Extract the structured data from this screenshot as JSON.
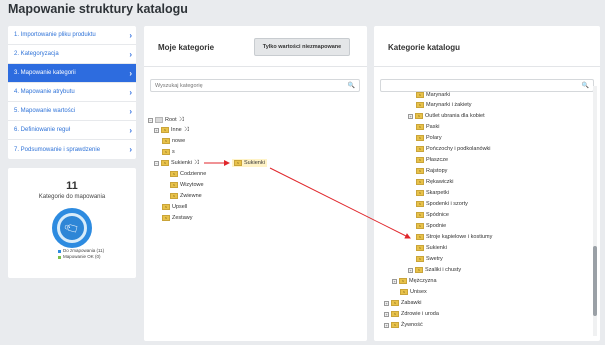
{
  "page": {
    "title": "Mapowanie struktury katalogu"
  },
  "steps": [
    {
      "label": "1. Importowanie pliku produktu",
      "active": false
    },
    {
      "label": "2. Kategoryzacja",
      "active": false
    },
    {
      "label": "3. Mapowanie kategorii",
      "active": true
    },
    {
      "label": "4. Mapowanie atrybutu",
      "active": false
    },
    {
      "label": "5. Mapowanie wartości",
      "active": false
    },
    {
      "label": "6. Definiowanie reguł",
      "active": false
    },
    {
      "label": "7. Podsumowanie i sprawdzenie",
      "active": false
    }
  ],
  "stats": {
    "count": "11",
    "label": "Kategorie do mapowania",
    "legend": [
      {
        "label": "Do zmapowania (11)",
        "color": "#2d8be0"
      },
      {
        "label": "Mapowanie OK (0)",
        "color": "#7cc04b"
      }
    ]
  },
  "left_panel": {
    "title": "Moje kategorie",
    "button": "Tylko wartości niezmapowane",
    "search_placeholder": "Wyszukaj kategorię",
    "tree": {
      "root": "Root",
      "inne": "Inne",
      "nowe": "nowe",
      "s": "s",
      "sukienki": "Sukienki",
      "codzienne": "Codzienne",
      "wizytowe": "Wizytowe",
      "zwiewne": "Zwiewne",
      "upsell": "Upsell",
      "zestawy": "Zestawy",
      "mapped_to": "Sukienki"
    }
  },
  "right_panel": {
    "title": "Kategorie katalogu",
    "search_placeholder": "",
    "tree": [
      "Marynarki",
      "Marynarki i żakiety",
      "Outlet ubrania dla kobiet",
      "Paski",
      "Polary",
      "Pończochy i podkolanówki",
      "Płaszcze",
      "Rajstopy",
      "Rękawiczki",
      "Skarpetki",
      "Spodenki i szorty",
      "Spódnice",
      "Spodnie",
      "Stroje kąpielowe i kostiumy",
      "Sukienki",
      "Swetry",
      "Szaliki i chusty",
      "Mężczyzna",
      "Unisex",
      "Zabawki",
      "Zdrowie i uroda",
      "Żywność"
    ]
  }
}
